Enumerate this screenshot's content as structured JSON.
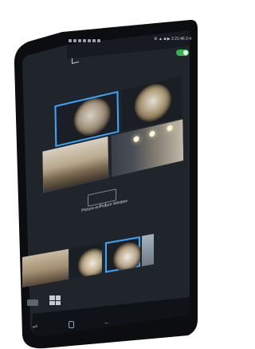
{
  "status_bar": {
    "right_text": "⚙ ▲ ■ ▶ 3 21:46 2:4"
  },
  "toolbar": {
    "toggle_on": true
  },
  "cameras": [
    {
      "id": "cam-1",
      "kind": "fisheye",
      "selected": true
    },
    {
      "id": "cam-2",
      "kind": "fisheye",
      "selected": false
    },
    {
      "id": "cam-3",
      "kind": "office",
      "selected": true
    },
    {
      "id": "cam-4",
      "kind": "hallway",
      "selected": false
    }
  ],
  "pip": {
    "label": "Picture-in-Picture Window"
  },
  "thumbnails": [
    {
      "kind": "office"
    },
    {
      "kind": "fisheye"
    },
    {
      "kind": "fisheye",
      "selected": true
    },
    {
      "kind": "partial"
    }
  ],
  "colors": {
    "accent": "#3aa8ff",
    "toggle_on": "#37b24d",
    "screen_bg": "#20252c",
    "phone_body": "#0b0d10"
  },
  "icons": {
    "back": "back-arrow-icon",
    "layout_single": "single-view-icon",
    "layout_grid": "grid-view-icon",
    "nav_recents": "recents-icon",
    "nav_home": "home-icon",
    "nav_back": "back-icon"
  }
}
